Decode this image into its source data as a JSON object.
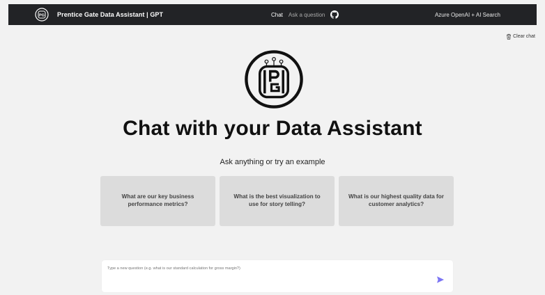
{
  "header": {
    "title": "Prentice Gate Data Assistant | GPT",
    "logo_icon": "pg-logo-icon",
    "nav": {
      "chat_label": "Chat",
      "ask_label": "Ask a question",
      "github_icon": "github-icon"
    },
    "right_label": "Azure OpenAI + AI Search"
  },
  "toolbar": {
    "clear_chat_label": "Clear chat",
    "clear_chat_icon": "trash-icon"
  },
  "hero": {
    "logo_icon": "pg-logo-icon",
    "title": "Chat with your Data Assistant",
    "subtitle": "Ask anything or try an example"
  },
  "examples": [
    {
      "text": "What are our key business performance metrics?"
    },
    {
      "text": "What is the best visualization to use for story telling?"
    },
    {
      "text": "What is our highest quality data for customer analytics?"
    }
  ],
  "composer": {
    "placeholder": "Type a new question (e.g. what is our standard calculation for gross margin?)",
    "send_icon": "send-icon"
  },
  "colors": {
    "topbar_bg": "#222326",
    "page_bg": "#f2f2f2",
    "card_bg": "#dcdcdc",
    "send_accent": "#7c75f4"
  }
}
